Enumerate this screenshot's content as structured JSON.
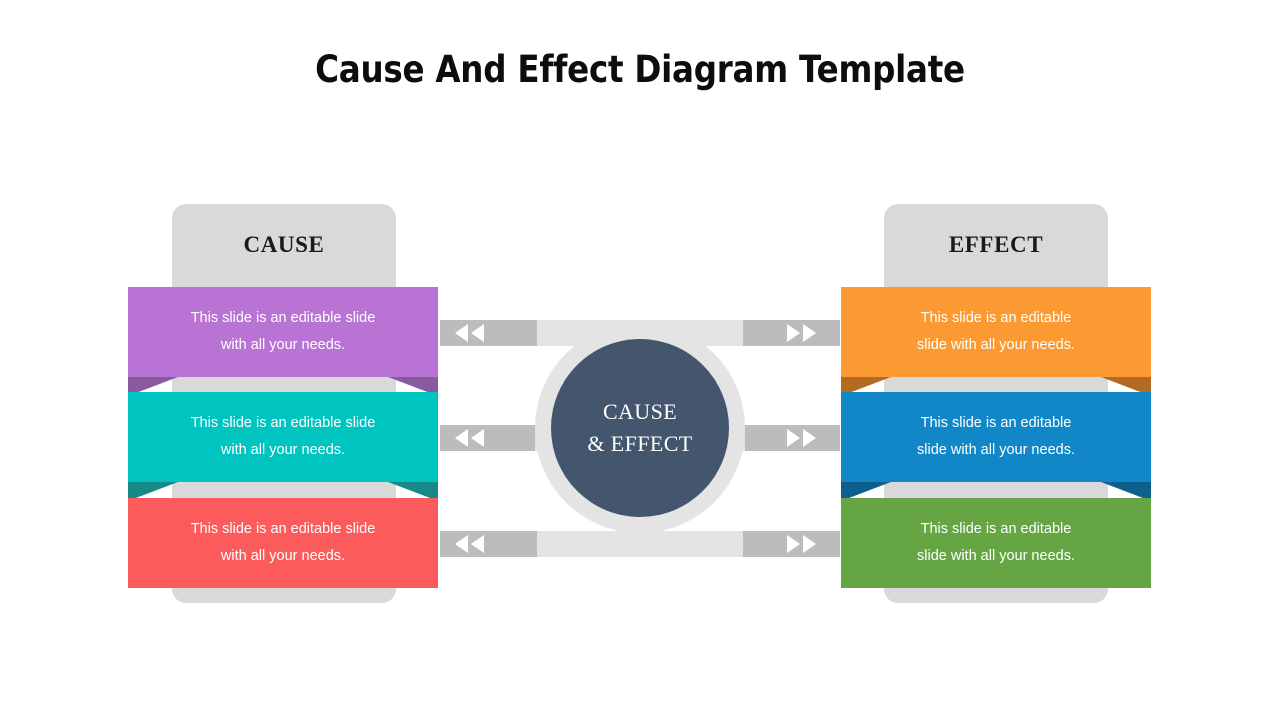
{
  "title": "Cause And Effect Diagram Template",
  "center": {
    "line1": "CAUSE",
    "line2": "& EFFECT",
    "color": "#44556e"
  },
  "panels": {
    "cause_label": "CAUSE",
    "effect_label": "EFFECT",
    "panel_color": "#d9d9d9"
  },
  "cause_items": [
    {
      "id": "purple",
      "line1": "This slide is an editable slide",
      "line2": "with all your needs.",
      "color": "#b973d4",
      "fold_color": "#8a5aa0"
    },
    {
      "id": "teal",
      "line1": "This slide is an editable slide",
      "line2": "with all your needs.",
      "color": "#00c4c0",
      "fold_color": "#168a86"
    },
    {
      "id": "red",
      "line1": "This slide is an editable slide",
      "line2": "with all your needs.",
      "color": "#fb5b5b",
      "fold_color": "#c43f3f"
    }
  ],
  "effect_items": [
    {
      "id": "orange",
      "line1": "This slide is an editable",
      "line2": "slide with all your needs.",
      "color": "#fb9a33",
      "fold_color": "#b36a21"
    },
    {
      "id": "blue",
      "line1": "This slide is an editable",
      "line2": "slide with all your needs.",
      "color": "#1287c8",
      "fold_color": "#0e5f8c"
    },
    {
      "id": "green",
      "line1": "This slide is an editable",
      "line2": "slide with all your needs.",
      "color": "#66a544",
      "fold_color": "#497a2e"
    }
  ],
  "connectors": {
    "bar_color": "#bcbcbc",
    "ring_color": "#e4e4e4",
    "left_arrow_icon": "double-chevron-left",
    "right_arrow_icon": "double-chevron-right",
    "rows": 3
  }
}
